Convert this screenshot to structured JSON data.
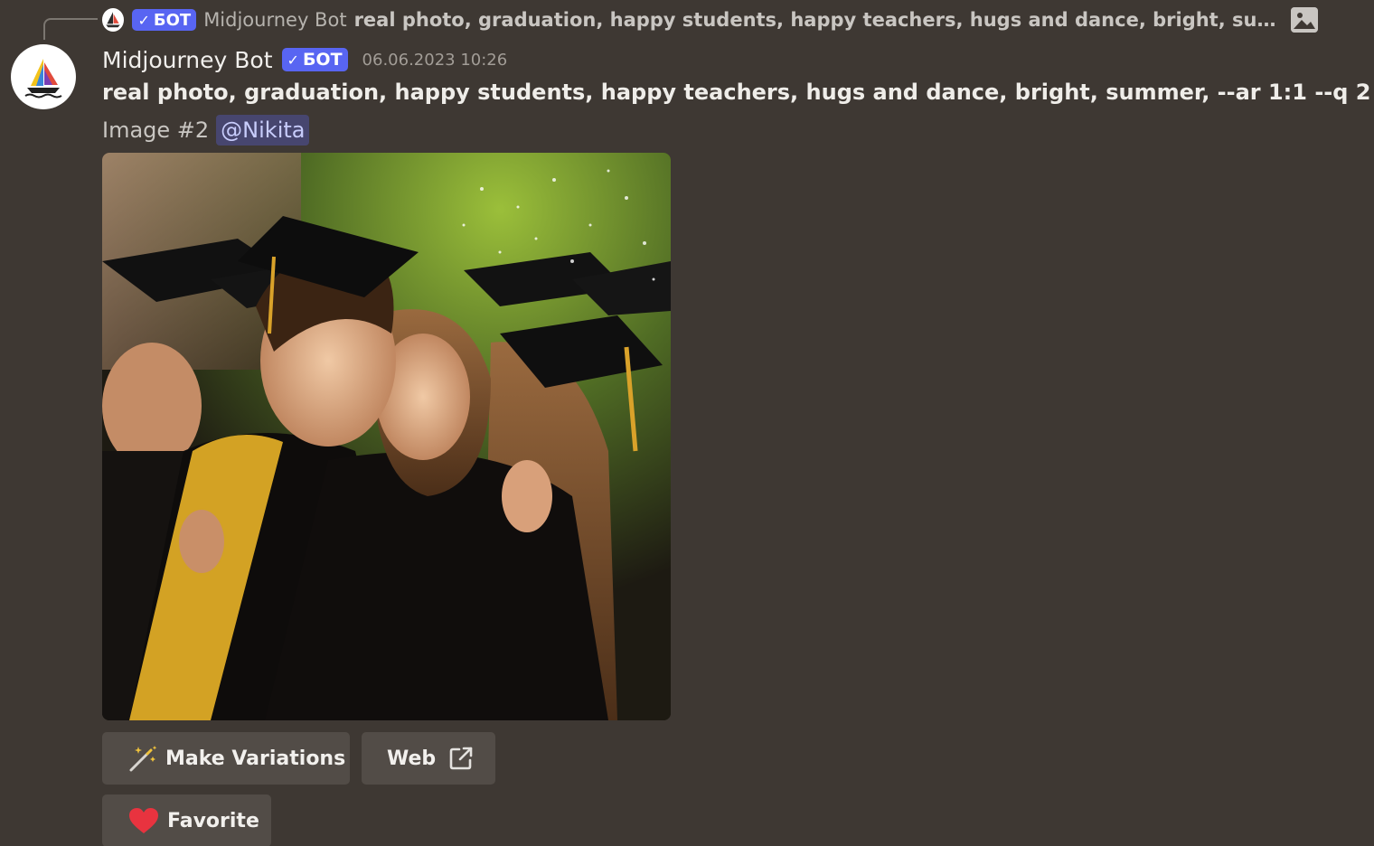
{
  "reply": {
    "badge_label": "БОТ",
    "author": "Midjourney Bot",
    "content": "real photo, graduation, happy students, happy teachers, hugs and dance, bright, summer…"
  },
  "message": {
    "author": "Midjourney Bot",
    "badge_label": "БОТ",
    "timestamp": "06.06.2023 10:26",
    "prompt": "real photo, graduation, happy students, happy teachers, hugs and dance, bright, summer, --ar 1:1 --q 2 -",
    "image_label": "Image #2",
    "mention": "@Nikita"
  },
  "buttons": {
    "variations": "Make Variations",
    "web": "Web",
    "favorite": "Favorite"
  },
  "icons": {
    "reply_avatar": "midjourney-boat-icon",
    "bot_check": "checkmark-icon",
    "image_attachment": "image-icon",
    "variations": "magic-wand-icon",
    "web": "external-link-icon",
    "favorite": "heart-icon"
  },
  "colors": {
    "background": "#3e3833",
    "bot_badge": "#5865f2",
    "mention_bg": "#47466f",
    "mention_text": "#c8cdfc",
    "button_bg": "#524c47",
    "heart": "#e8333f"
  }
}
